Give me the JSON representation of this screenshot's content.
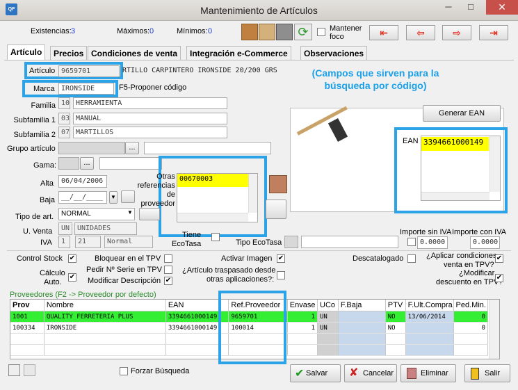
{
  "window": {
    "title": "Mantenimiento de Artículos",
    "app_icon": "QF",
    "minimize": "─",
    "maximize": "□",
    "close": "✕"
  },
  "top": {
    "existencias_label": "Existencias:",
    "existencias": "3",
    "maximos_label": "Máximos:",
    "maximos": "0",
    "minimos_label": "Mínimos:",
    "minimos": "0",
    "mantener_label": "Mantener",
    "foco_label": "foco"
  },
  "tabs": [
    "Artículo",
    "Precios",
    "Condiciones de venta",
    "Integración e-Commerce",
    "Observaciones"
  ],
  "form": {
    "articulo_label": "Artículo",
    "articulo": "9659701",
    "descripcion": "RTILLO CARPINTERO  IRONSIDE 20/200 GRS",
    "marca_label": "Marca",
    "marca": "IRONSIDE",
    "f5_hint": "F5-Proponer código",
    "familia_label": "Familia",
    "familia_code": "10",
    "familia": "HERRAMIENTA",
    "subfamilia1_label": "Subfamilia 1",
    "subfamilia1_code": "03",
    "subfamilia1": "MANUAL",
    "subfamilia2_label": "Subfamilia 2",
    "subfamilia2_code": "07",
    "subfamilia2": "MARTILLOS",
    "grupo_label": "Grupo artículo",
    "gama_label": "Gama:",
    "ellipsis": "...",
    "alta_label": "Alta",
    "alta": "06/04/2006",
    "baja_label": "Baja",
    "baja": "__/__/____",
    "otras_ref_label1": "Otras",
    "otras_ref_label2": "referencias",
    "otras_ref_label3": "de",
    "otras_ref_label4": "proveedor",
    "otras_ref_value": "00670003",
    "tipo_label": "Tipo de art.",
    "tipo": "NORMAL",
    "uventa_label": "U. Venta",
    "uventa_code": "UN",
    "uventa": "UNIDADES",
    "iva_label": "IVA",
    "iva_code": "1",
    "iva_pct": "21",
    "iva_tipo": "Normal",
    "tiene_label": "Tiene",
    "ecotasa_label": "EcoTasa",
    "tipo_ecotasa_label": "Tipo EcoTasa",
    "importe_sin_label": "Importe sin IVA",
    "importe_sin": "0.0000",
    "importe_con_label": "Importe con IVA",
    "importe_con": "0.0000",
    "ean_label": "EAN",
    "ean": "3394661000149",
    "generar_ean": "Generar EAN",
    "caption": "(Campos que sirven para la búsqueda por código)"
  },
  "checks": {
    "control_stock": "Control Stock",
    "calculo1": "Cálculo",
    "calculo2": "Auto.",
    "bloquear": "Bloquear en el TPV",
    "pedir_serie": "Pedir Nº Serie en TPV",
    "modificar_desc": "Modificar Descripción",
    "activar_imagen": "Activar Imagen",
    "traspasado1": "¿Artículo traspasado desde",
    "traspasado2": "otras aplicaciones?:",
    "descatalogado": "Descatalogado",
    "aplicar1": "¿Aplicar condiciones",
    "aplicar2": "venta en TPV?",
    "modificar1": "¿Modificar",
    "modificar2": "descuento en TPV?"
  },
  "proveedores": {
    "caption": "Proveedores (F2 -> Proveedor por defecto)",
    "columns": [
      "Prov",
      "Nombre",
      "EAN",
      "Ref.Proveedor",
      "Envase",
      "UCo",
      "F.Baja",
      "PTV",
      "F.Ult.Compra",
      "Ped.Min."
    ],
    "rows": [
      [
        "1001",
        "QUALITY FERRETERIA PLUS",
        "3394661000149",
        "9659701",
        "1",
        "UN",
        "",
        "NO",
        "13/06/2014",
        "0"
      ],
      [
        "100334",
        "IRONSIDE",
        "3394661000149",
        "100014",
        "1",
        "UN",
        "",
        "NO",
        "",
        "0"
      ]
    ]
  },
  "bottom": {
    "forzar": "Forzar Búsqueda",
    "salvar": "Salvar",
    "cancelar": "Cancelar",
    "eliminar": "Eliminar",
    "salir": "Salir"
  },
  "colors": {
    "highlight": "#2ba3e6",
    "row_selected": "#33ee33",
    "yellow": "#ffff00"
  }
}
